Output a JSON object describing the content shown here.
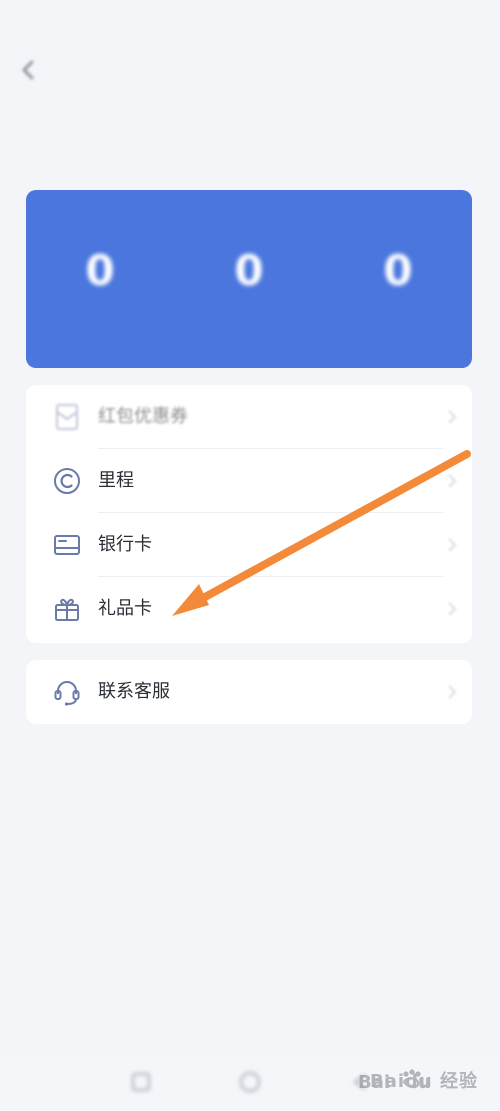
{
  "status_bar": {
    "left": "",
    "right": ""
  },
  "header": {
    "back_icon": "back-arrow-icon",
    "title": "",
    "link": ""
  },
  "balance_card": {
    "stats": [
      {
        "label": "",
        "value": "0"
      },
      {
        "label": "",
        "value": "0"
      },
      {
        "label": "",
        "value": "0"
      }
    ]
  },
  "menu": {
    "primary": [
      {
        "id": "coupon",
        "label": "红包优惠券",
        "icon": "coupon-icon"
      },
      {
        "id": "mileage",
        "label": "里程",
        "icon": "mileage-icon"
      },
      {
        "id": "bank-card",
        "label": "银行卡",
        "icon": "bank-card-icon"
      },
      {
        "id": "gift-card",
        "label": "礼品卡",
        "icon": "gift-icon"
      }
    ],
    "secondary": [
      {
        "id": "customer-service",
        "label": "联系客服",
        "icon": "headset-icon"
      }
    ]
  },
  "overlay": {
    "annotation_arrow_color": "#f38a3a"
  },
  "bottom_nav": {
    "icons": [
      "home-icon",
      "circle-icon",
      "back-icon"
    ]
  },
  "watermark": {
    "text": "Baidu 经验"
  },
  "colors": {
    "background": "#f3f5f9",
    "card": "#ffffff",
    "accent": "#4a76de",
    "icon": "#6b7ba8",
    "text": "#2b2f36"
  }
}
